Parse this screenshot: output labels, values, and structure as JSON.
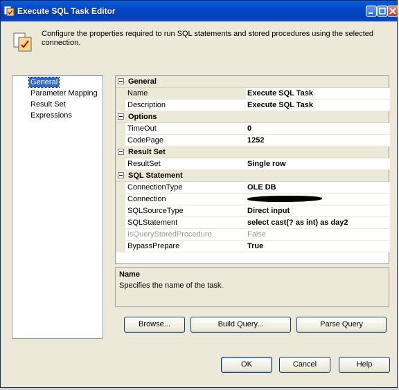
{
  "window": {
    "title": "Execute SQL Task Editor"
  },
  "title_buttons": {
    "minimize": "minimize-icon",
    "maximize": "maximize-icon",
    "close": "close-icon"
  },
  "header": {
    "description": "Configure the properties required to run SQL statements and stored procedures using the selected connection."
  },
  "nav": {
    "items": [
      {
        "label": "General",
        "selected": true
      },
      {
        "label": "Parameter Mapping"
      },
      {
        "label": "Result Set"
      },
      {
        "label": "Expressions"
      }
    ]
  },
  "grid": {
    "categories": {
      "general": "General",
      "options": "Options",
      "result_set": "Result Set",
      "sql_statement": "SQL Statement"
    },
    "props": {
      "name": {
        "label": "Name",
        "value": "Execute SQL Task"
      },
      "description": {
        "label": "Description",
        "value": "Execute SQL Task"
      },
      "timeout": {
        "label": "TimeOut",
        "value": "0"
      },
      "codepage": {
        "label": "CodePage",
        "value": "1252"
      },
      "resultset": {
        "label": "ResultSet",
        "value": "Single row"
      },
      "connectiontype": {
        "label": "ConnectionType",
        "value": "OLE DB"
      },
      "connection": {
        "label": "Connection",
        "value": ""
      },
      "sqlsourcetype": {
        "label": "SQLSourceType",
        "value": "Direct input"
      },
      "sqlstatement": {
        "label": "SQLStatement",
        "value": "select cast(? as int) as  day2"
      },
      "isquerystoredprocedure": {
        "label": "IsQueryStoredProcedure",
        "value": "False"
      },
      "bypassprepare": {
        "label": "BypassPrepare",
        "value": "True"
      }
    }
  },
  "desc": {
    "title": "Name",
    "text": "Specifies the name of the task."
  },
  "buttons": {
    "browse": "Browse...",
    "build_query": "Build Query...",
    "parse_query": "Parse Query",
    "ok": "OK",
    "cancel": "Cancel",
    "help": "Help"
  },
  "colors": {
    "titlebar": "#0347c6",
    "selection": "#3169c6",
    "dialog_bg": "#ece9d8"
  }
}
